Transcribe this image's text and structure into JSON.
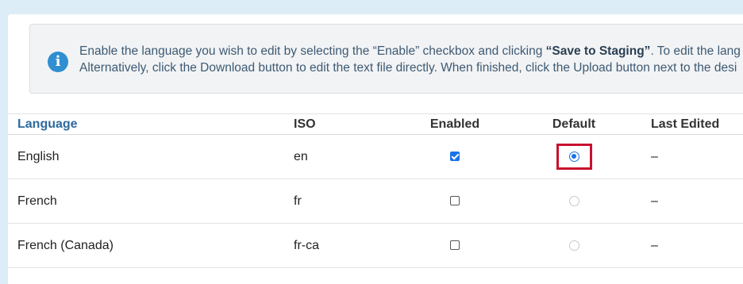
{
  "info": {
    "line1_pre": "Enable the language you wish to edit by selecting the “Enable” checkbox and clicking ",
    "line1_bold": "“Save to Staging”",
    "line1_post": ". To edit the lang",
    "line2": "Alternatively, click the Download button to edit the text file directly. When finished, click the Upload button next to the desi"
  },
  "table": {
    "headers": {
      "language": "Language",
      "iso": "ISO",
      "enabled": "Enabled",
      "default": "Default",
      "last_edited": "Last Edited"
    },
    "rows": [
      {
        "language": "English",
        "iso": "en",
        "enabled": true,
        "default": true,
        "last_edited": "–"
      },
      {
        "language": "French",
        "iso": "fr",
        "enabled": false,
        "default": false,
        "last_edited": "–"
      },
      {
        "language": "French (Canada)",
        "iso": "fr-ca",
        "enabled": false,
        "default": false,
        "last_edited": "–"
      }
    ]
  },
  "colors": {
    "accent": "#1a73e8",
    "highlight": "#c8102e",
    "info_icon": "#2f8fd0",
    "header_link": "#2d6a9e"
  },
  "icons": {
    "info": "info-circle-icon"
  }
}
